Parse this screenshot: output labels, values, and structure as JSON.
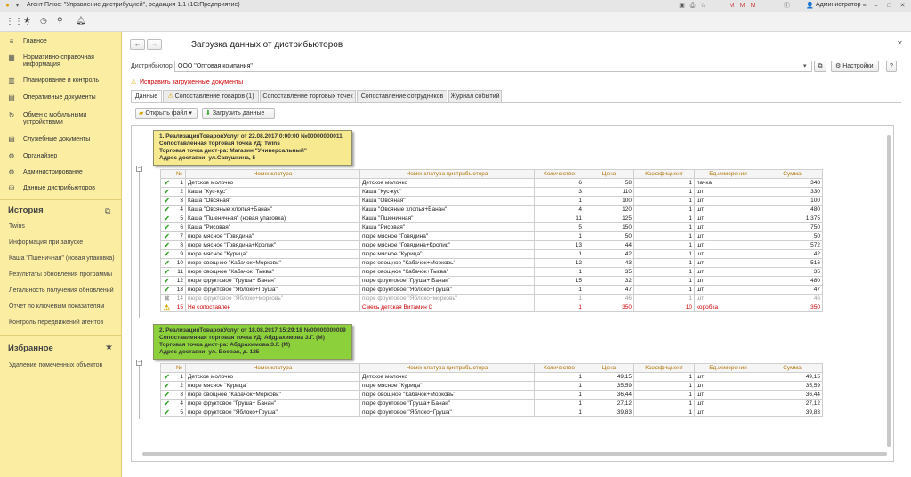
{
  "window": {
    "title": "Агент Плюс: \"Управление дистрибуцией\", редакция 1.1  (1С:Предприятие)",
    "user": "Администратор"
  },
  "sidebar": {
    "items": [
      {
        "label": "Главное",
        "icon": "menu-icon"
      },
      {
        "label": "Нормативно-справочная информация",
        "icon": "list-icon"
      },
      {
        "label": "Планирование и контроль",
        "icon": "chart-icon"
      },
      {
        "label": "Оперативные документы",
        "icon": "document-icon"
      },
      {
        "label": "Обмен с мобильными устройствами",
        "icon": "sync-icon"
      },
      {
        "label": "Служебные документы",
        "icon": "document-icon"
      },
      {
        "label": "Органайзер",
        "icon": "organizer-icon"
      },
      {
        "label": "Администрирование",
        "icon": "gear-icon"
      },
      {
        "label": "Данные дистрибьюторов",
        "icon": "data-icon"
      }
    ],
    "history": {
      "title": "История",
      "items": [
        "Twins",
        "Информация при запуске",
        "Каша \"Пшеничная\" (новая упаковка)",
        "Результаты обновления программы",
        "Легальность получения обновлений",
        "Отчет по ключевым показателям",
        "Контроль передвижений агентов"
      ]
    },
    "favorites": {
      "title": "Избранное",
      "items": [
        "Удаление помеченных объектов"
      ]
    }
  },
  "form": {
    "title": "Загрузка данных от дистрибьюторов",
    "distributor_label": "Дистрибьютор:",
    "distributor_value": "ООО \"Оптовая компания\"",
    "settings_label": "Настройки",
    "help_label": "?",
    "fix_link": "Исправить загруженные документы",
    "tabs": [
      "Данные",
      "Сопоставление товаров (1)",
      "Сопоставление торговых точек",
      "Сопоставление сотрудников",
      "Журнал событий"
    ],
    "open_file_label": "Открыть файл",
    "load_data_label": "Загрузить данные"
  },
  "columns": [
    "№",
    "Номенклатура",
    "Номенклатура дистрибьютора",
    "Количество",
    "Цена",
    "Коэффициент",
    "Ед.измерения",
    "Сумма"
  ],
  "doc1": {
    "lines": [
      "1. РеализацияТоваровУслуг от 22.08.2017 0:00:00 №00000000011",
      "Сопоставленная торговая точка УД: Twins",
      "Торговая точка дист-ра: Магазин \"Универсальный\"",
      "Адрес доставки: ул.Савушкина, 5"
    ],
    "rows": [
      {
        "n": "1",
        "nom": "Детское молочко",
        "dnom": "Детское молочко",
        "qty": "6",
        "price": "58",
        "k": "1",
        "unit": "пачка",
        "sum": "348",
        "st": "ok"
      },
      {
        "n": "2",
        "nom": "Каша \"Кус-кус\"",
        "dnom": "Каша \"Кус-кус\"",
        "qty": "3",
        "price": "110",
        "k": "1",
        "unit": "шт",
        "sum": "330",
        "st": "ok"
      },
      {
        "n": "3",
        "nom": "Каша \"Овсяная\"",
        "dnom": "Каша \"Овсяная\"",
        "qty": "1",
        "price": "100",
        "k": "1",
        "unit": "шт",
        "sum": "100",
        "st": "ok"
      },
      {
        "n": "4",
        "nom": "Каша \"Овсяные хлопья+Банан\"",
        "dnom": "Каша \"Овсяные хлопья+Банан\"",
        "qty": "4",
        "price": "120",
        "k": "1",
        "unit": "шт",
        "sum": "480",
        "st": "ok"
      },
      {
        "n": "5",
        "nom": "Каша \"Пшеничная\" (новая упаковка)",
        "dnom": "Каша \"Пшеничная\"",
        "qty": "11",
        "price": "125",
        "k": "1",
        "unit": "шт",
        "sum": "1 375",
        "st": "ok"
      },
      {
        "n": "6",
        "nom": "Каша \"Рисовая\"",
        "dnom": "Каша \"Рисовая\"",
        "qty": "5",
        "price": "150",
        "k": "1",
        "unit": "шт",
        "sum": "750",
        "st": "ok"
      },
      {
        "n": "7",
        "nom": "пюре мясное \"Говядина\"",
        "dnom": "пюре мясное \"Говядина\"",
        "qty": "1",
        "price": "50",
        "k": "1",
        "unit": "шт",
        "sum": "50",
        "st": "ok"
      },
      {
        "n": "8",
        "nom": "пюре мясное \"Говядина+Кролик\"",
        "dnom": "пюре мясное \"Говядина+Кролик\"",
        "qty": "13",
        "price": "44",
        "k": "1",
        "unit": "шт",
        "sum": "572",
        "st": "ok"
      },
      {
        "n": "9",
        "nom": "пюре мясное \"Курица\"",
        "dnom": "пюре мясное \"Курица\"",
        "qty": "1",
        "price": "42",
        "k": "1",
        "unit": "шт",
        "sum": "42",
        "st": "ok"
      },
      {
        "n": "10",
        "nom": "пюре овощное \"Кабачок+Морковь\"",
        "dnom": "пюре овощное \"Кабачок+Морковь\"",
        "qty": "12",
        "price": "43",
        "k": "1",
        "unit": "шт",
        "sum": "516",
        "st": "ok"
      },
      {
        "n": "11",
        "nom": "пюре овощное \"Кабачок+Тыква\"",
        "dnom": "пюре овощное \"Кабачок+Тыква\"",
        "qty": "1",
        "price": "35",
        "k": "1",
        "unit": "шт",
        "sum": "35",
        "st": "ok"
      },
      {
        "n": "12",
        "nom": "пюре фруктовое \"Груша+ Банан\"",
        "dnom": "пюре фруктовое \"Груша+ Банан\"",
        "qty": "15",
        "price": "32",
        "k": "1",
        "unit": "шт",
        "sum": "480",
        "st": "ok"
      },
      {
        "n": "13",
        "nom": "пюре фруктовое \"Яблоко+Груша\"",
        "dnom": "пюре фруктовое \"Яблоко+Груша\"",
        "qty": "1",
        "price": "47",
        "k": "1",
        "unit": "шт",
        "sum": "47",
        "st": "ok"
      },
      {
        "n": "14",
        "nom": "пюре фруктовое \"Яблоко+морковь\"",
        "dnom": "пюре фруктовое \"Яблоко+морковь\"",
        "qty": "1",
        "price": "46",
        "k": "1",
        "unit": "шт",
        "sum": "46",
        "st": "gray"
      },
      {
        "n": "15",
        "nom": "Не сопоставлен",
        "dnom": "Смесь детская Витамин С",
        "qty": "1",
        "price": "350",
        "k": "10",
        "unit": "коробка",
        "sum": "350",
        "st": "warn"
      }
    ]
  },
  "doc2": {
    "lines": [
      "2. РеализацияТоваровУслуг от 18.08.2017 15:29:18 №00000000009",
      "Сопоставленная торговая точка УД: Абдрахимова З.Г. (М)",
      "Торговая точка дист-ра: Абдрахимова З.Г. (М)",
      "Адрес доставки: ул. Боевая, д. 125"
    ],
    "rows": [
      {
        "n": "1",
        "nom": "Детское молочко",
        "dnom": "Детское молочко",
        "qty": "1",
        "price": "49,15",
        "k": "1",
        "unit": "шт",
        "sum": "49,15",
        "st": "ok"
      },
      {
        "n": "2",
        "nom": "пюре мясное \"Курица\"",
        "dnom": "пюре мясное \"Курица\"",
        "qty": "1",
        "price": "35,59",
        "k": "1",
        "unit": "шт",
        "sum": "35,59",
        "st": "ok"
      },
      {
        "n": "3",
        "nom": "пюре овощное \"Кабачок+Морковь\"",
        "dnom": "пюре овощное \"Кабачок+Морковь\"",
        "qty": "1",
        "price": "36,44",
        "k": "1",
        "unit": "шт",
        "sum": "36,44",
        "st": "ok"
      },
      {
        "n": "4",
        "nom": "пюре фруктовое \"Груша+ Банан\"",
        "dnom": "пюре фруктовое \"Груша+ Банан\"",
        "qty": "1",
        "price": "27,12",
        "k": "1",
        "unit": "шт",
        "sum": "27,12",
        "st": "ok"
      },
      {
        "n": "5",
        "nom": "пюре фруктовое \"Яблоко+Груша\"",
        "dnom": "пюре фруктовое \"Яблоко+Груша\"",
        "qty": "1",
        "price": "39,83",
        "k": "1",
        "unit": "шт",
        "sum": "39,83",
        "st": "ok"
      }
    ]
  },
  "colors": {
    "sidebar_bg": "#fbeea3",
    "card1_bg": "#f7e98f",
    "card2_bg": "#8cd13c",
    "check": "#3aa52f",
    "error": "#cc0000"
  }
}
